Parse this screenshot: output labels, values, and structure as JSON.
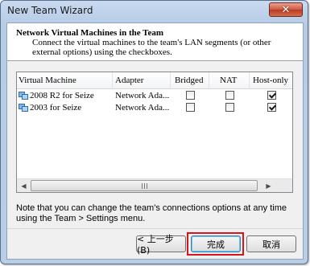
{
  "window": {
    "title": "New Team Wizard",
    "close_glyph": "✕"
  },
  "header": {
    "title": "Network Virtual Machines in the Team",
    "description": "Connect the virtual machines to the team's LAN segments (or other external options) using the checkboxes."
  },
  "table": {
    "columns": [
      "Virtual Machine",
      "Adapter",
      "Bridged",
      "NAT",
      "Host-only"
    ],
    "rows": [
      {
        "name": "2008 R2 for Seize",
        "adapter": "Network Ada...",
        "bridged": false,
        "nat": false,
        "host_only": true,
        "icon": "vm-icon"
      },
      {
        "name": "2003 for Seize",
        "adapter": "Network Ada...",
        "bridged": false,
        "nat": false,
        "host_only": true,
        "icon": "vm-icon"
      }
    ]
  },
  "scrollbar": {
    "left_arrow": "◀",
    "right_arrow": "▶"
  },
  "note": "Note that you can change the team's connections options at any time using the Team > Settings menu.",
  "buttons": {
    "back": "< 上一步(B)",
    "finish": "完成",
    "cancel": "取消"
  },
  "colors": {
    "highlight": "#d5161b",
    "titlebar": "#b9cde6",
    "close": "#c9452a"
  }
}
